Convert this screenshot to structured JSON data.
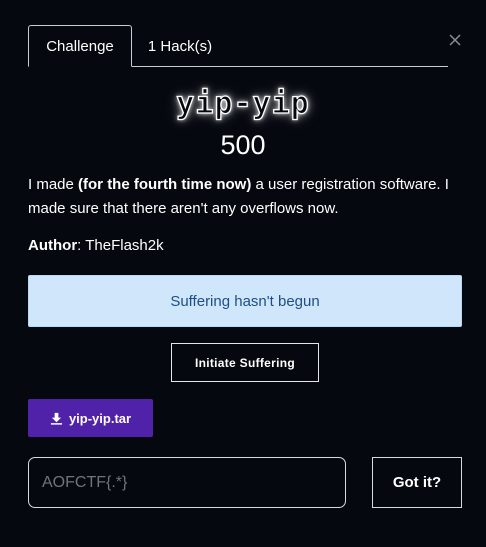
{
  "tabs": [
    {
      "label": "Challenge",
      "active": true
    },
    {
      "label": "1 Hack(s)",
      "active": false
    }
  ],
  "challenge": {
    "name": "yip-yip",
    "points": "500",
    "description_parts": [
      "I made ",
      "(for the fourth time now)",
      " a user registration software. I made sure that there aren't any overflows now."
    ],
    "author_label": "Author",
    "author_separator": ": ",
    "author_name": "TheFlash2k"
  },
  "status_message": "Suffering hasn't begun",
  "action_button": "Initiate Suffering",
  "file": {
    "name": "yip-yip.tar",
    "icon": "download-icon"
  },
  "flag_input": {
    "placeholder": "AOFCTF{.*}",
    "value": ""
  },
  "submit_button": "Got it?",
  "icons": {
    "close": "close-icon",
    "download": "download-icon"
  },
  "colors": {
    "background": "#05080f",
    "alert_bg": "#d0e6fb",
    "alert_text": "#1d4f86",
    "file_button": "#5021a9"
  }
}
